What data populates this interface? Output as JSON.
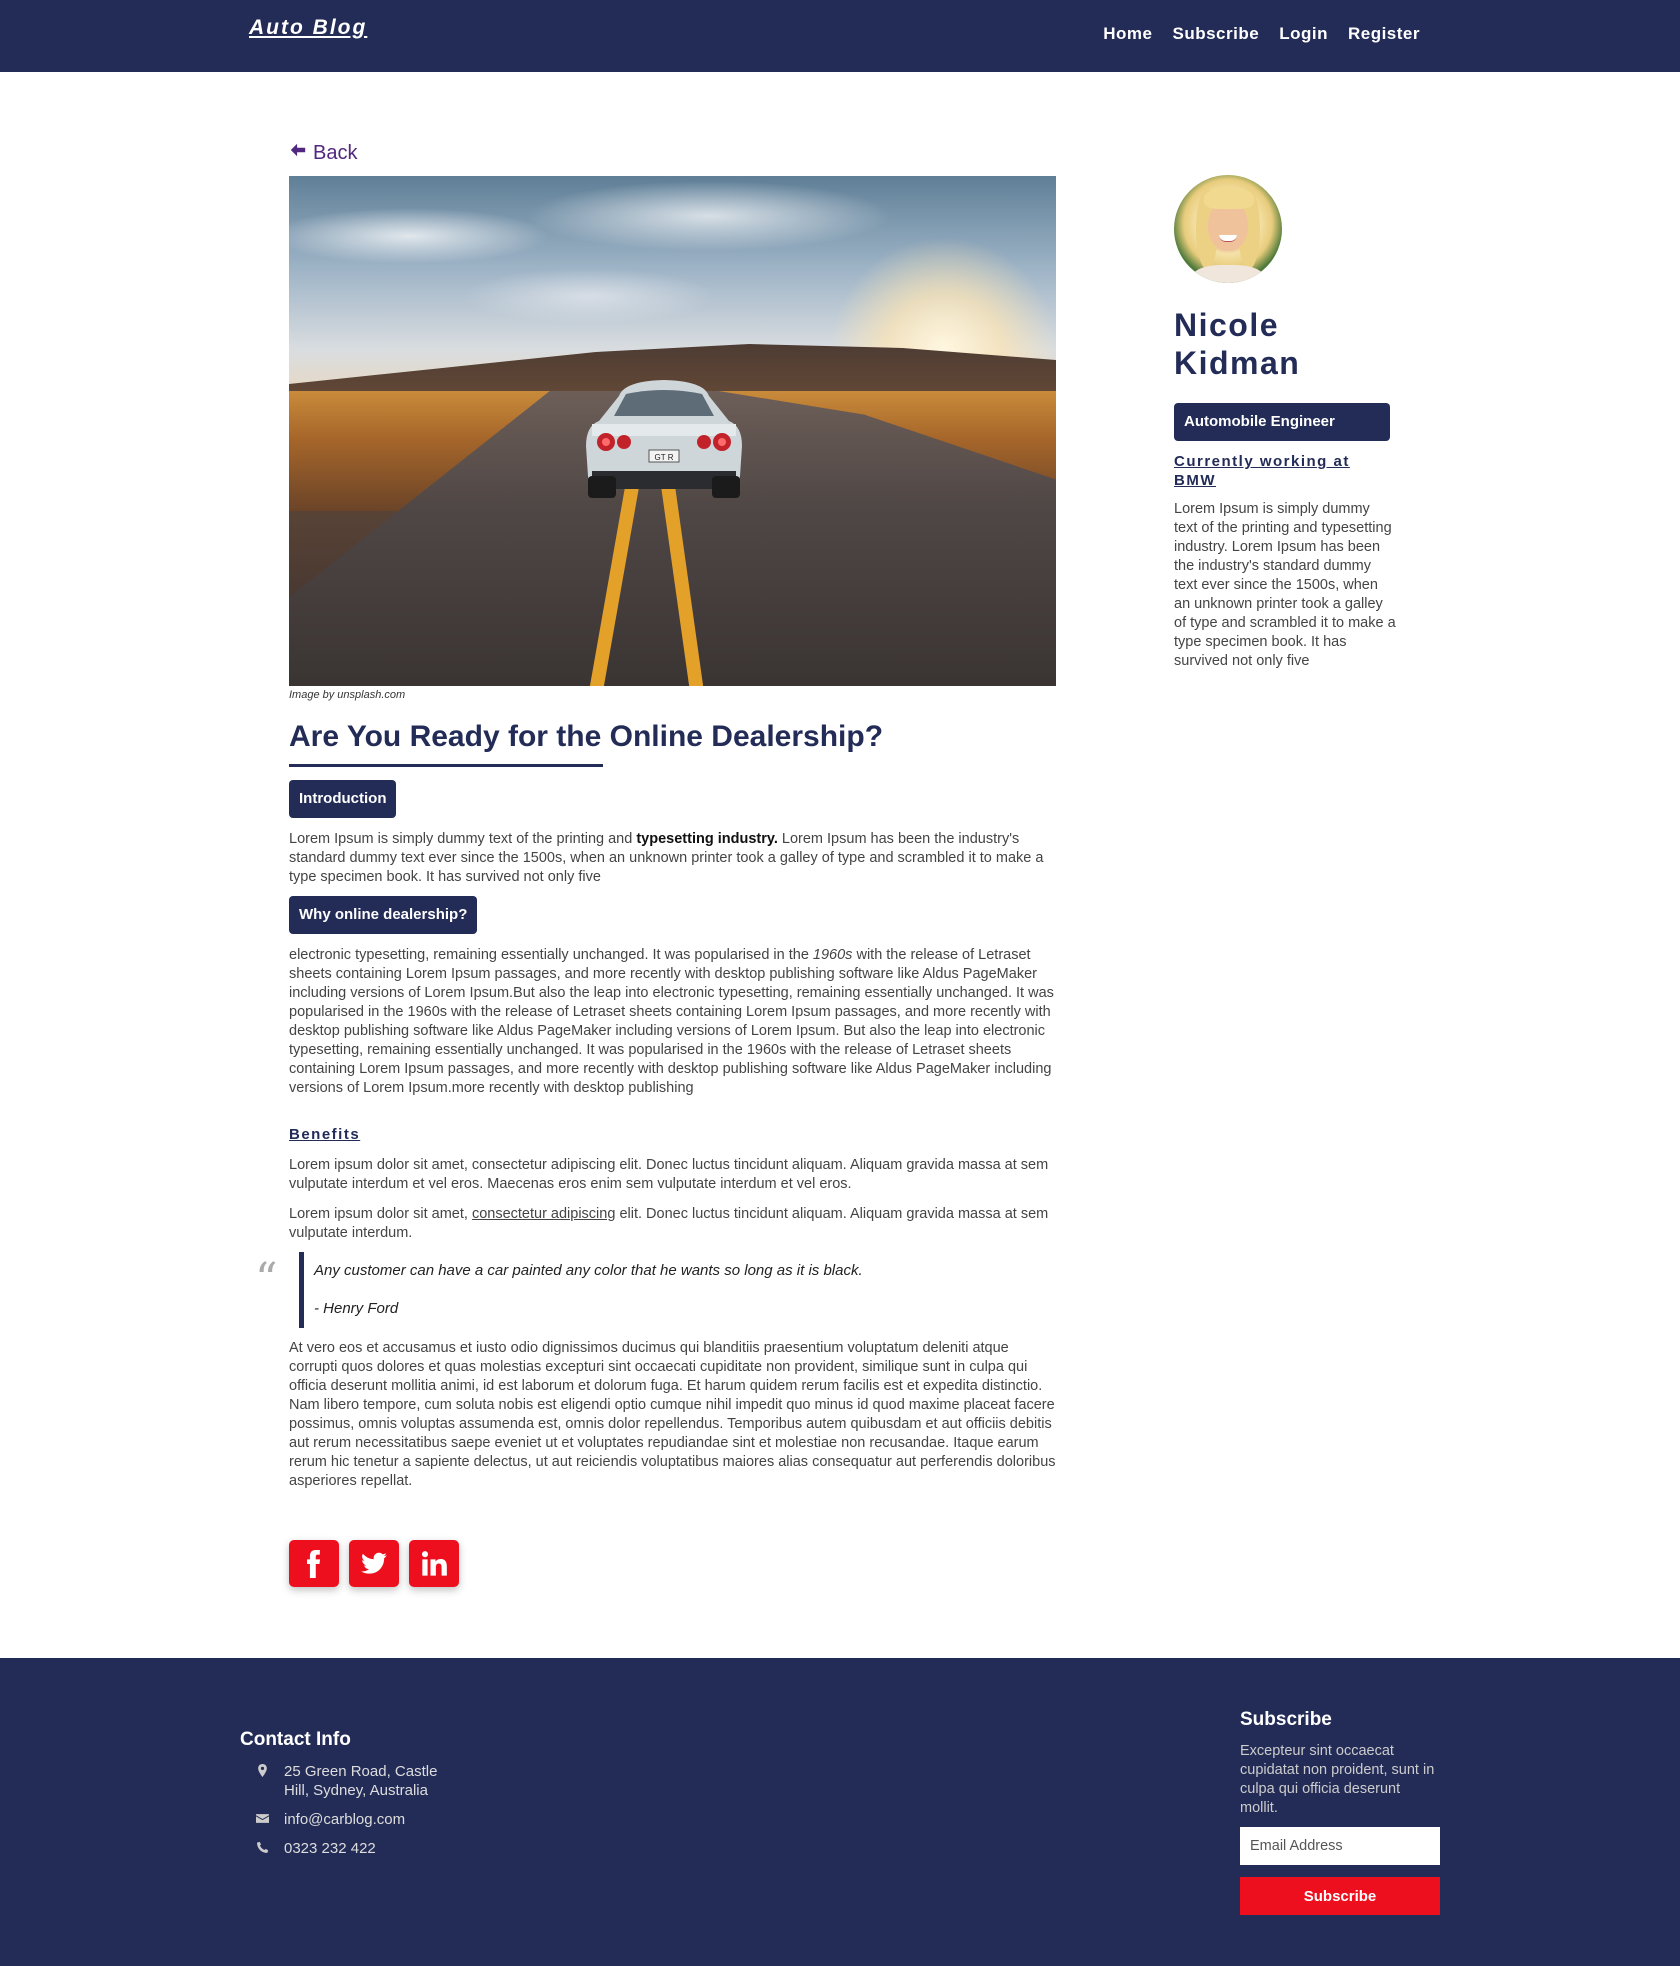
{
  "navbar": {
    "brand": "Auto Blog",
    "links": [
      "Home",
      "Subscribe",
      "Login",
      "Register"
    ]
  },
  "back_label": "Back",
  "hero": {
    "caption": "Image by unsplash.com",
    "plate_text": "GT R"
  },
  "article": {
    "title": "Are You Ready for the Online Dealership?",
    "intro_tag": "Introduction",
    "intro_text_before": "Lorem Ipsum is simply dummy text of the printing and ",
    "intro_text_bold": "typesetting industry.",
    "intro_text_after": " Lorem Ipsum has been the industry's standard dummy text ever since the 1500s, when an unknown printer took a galley of type and scrambled it to make a type specimen book. It has survived not only five",
    "why_tag": "Why online dealership?",
    "why_text_before": "electronic typesetting, remaining essentially unchanged. It was popularised in the ",
    "why_text_italic": "1960s",
    "why_text_after": " with the release of Letraset sheets containing Lorem Ipsum passages, and more recently with desktop publishing software like Aldus PageMaker including versions of Lorem Ipsum.But also the leap into electronic typesetting, remaining essentially unchanged. It was popularised in the 1960s with the release of Letraset sheets containing Lorem Ipsum passages, and more recently with desktop publishing software like Aldus PageMaker including versions of Lorem Ipsum. But also the leap into electronic typesetting, remaining essentially unchanged. It was popularised in the 1960s with the release of Letraset sheets containing Lorem Ipsum passages, and more recently with desktop publishing software like Aldus PageMaker including versions of Lorem Ipsum.more recently with desktop publishing",
    "benefits_heading": "Benefits",
    "benefits_p1": "Lorem ipsum dolor sit amet, consectetur adipiscing elit. Donec luctus tincidunt aliquam. Aliquam gravida massa at sem vulputate interdum et vel eros. Maecenas eros enim sem vulputate interdum et vel eros.",
    "benefits_p2_before": "Lorem ipsum dolor sit amet, ",
    "benefits_p2_link": "consectetur adipiscing",
    "benefits_p2_after": " elit. Donec luctus tincidunt aliquam. Aliquam gravida massa at sem vulputate interdum.",
    "quote_mark": "“",
    "quote": "Any customer can have a car painted any color that he wants so long as it is black.",
    "quote_author": "- Henry Ford",
    "closing": "At vero eos et accusamus et iusto odio dignissimos ducimus qui blanditiis praesentium voluptatum deleniti atque corrupti quos dolores et quas molestias excepturi sint occaecati cupiditate non provident, similique sunt in culpa qui officia deserunt mollitia animi, id est laborum et dolorum fuga. Et harum quidem rerum facilis est et expedita distinctio. Nam libero tempore, cum soluta nobis est eligendi optio cumque nihil impedit quo minus id quod maxime placeat facere possimus, omnis voluptas assumenda est, omnis dolor repellendus. Temporibus autem quibusdam et aut officiis debitis aut rerum necessitatibus saepe eveniet ut et voluptates repudiandae sint et molestiae non recusandae. Itaque earum rerum hic tenetur a sapiente delectus, ut aut reiciendis voluptatibus maiores alias consequatur aut perferendis doloribus asperiores repellat.",
    "social_icons": [
      "facebook-icon",
      "twitter-icon",
      "linkedin-icon"
    ],
    "social_color": "#ed0f1e"
  },
  "author": {
    "first_name": "Nicole",
    "last_name": "Kidman",
    "role": "Automobile Engineer",
    "work": "Currently working at BMW",
    "bio": "Lorem Ipsum is simply dummy text of the printing and typesetting industry. Lorem Ipsum has been the industry's standard dummy text ever since the 1500s, when an unknown printer took a galley of type and scrambled it to make a type specimen book. It has survived not only five"
  },
  "footer": {
    "contact_title": "Contact Info",
    "address_line1": "25 Green Road, Castle",
    "address_line2": "Hill, Sydney, Australia",
    "email": "info@carblog.com",
    "phone": "0323 232 422",
    "subscribe_title": "Subscribe",
    "subscribe_text": "Excepteur sint occaecat cupidatat non proident, sunt in culpa qui officia deserunt mollit.",
    "email_placeholder": "Email Address",
    "subscribe_button": "Subscribe"
  },
  "colors": {
    "navy": "#232c57",
    "accent_red": "#ed0f1e",
    "back_purple": "#51277f"
  }
}
